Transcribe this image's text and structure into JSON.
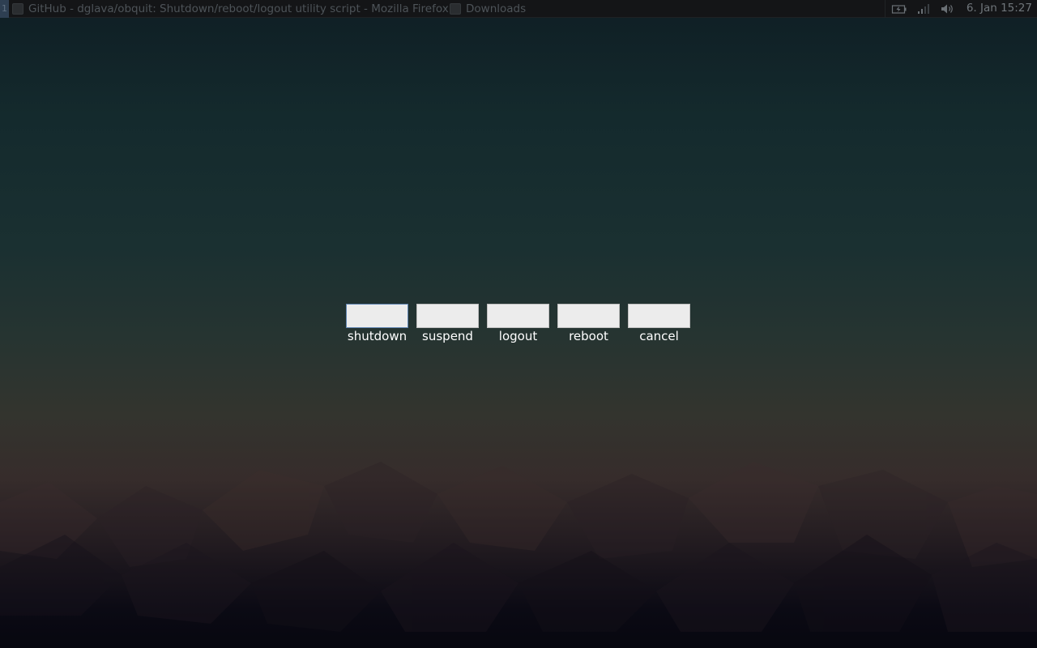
{
  "panel": {
    "workspace": "1",
    "tasks": [
      {
        "title": "GitHub - dglava/obquit: Shutdown/reboot/logout utility script - Mozilla Firefox",
        "icon": "firefox-icon"
      },
      {
        "title": "Downloads",
        "icon": "folder-icon"
      }
    ],
    "tray": {
      "icons": [
        "battery-icon",
        "network-signal-icon",
        "volume-icon"
      ],
      "clock": "6. Jan 15:27"
    }
  },
  "dialog": {
    "actions": [
      {
        "label": "shutdown",
        "focused": true
      },
      {
        "label": "suspend",
        "focused": false
      },
      {
        "label": "logout",
        "focused": false
      },
      {
        "label": "reboot",
        "focused": false
      },
      {
        "label": "cancel",
        "focused": false
      }
    ]
  },
  "colors": {
    "panel_bg": "#141517",
    "panel_text": "#4d5358",
    "button_bg": "#ececec",
    "focus_border": "#5e83b0",
    "label_text": "#ffffff"
  }
}
